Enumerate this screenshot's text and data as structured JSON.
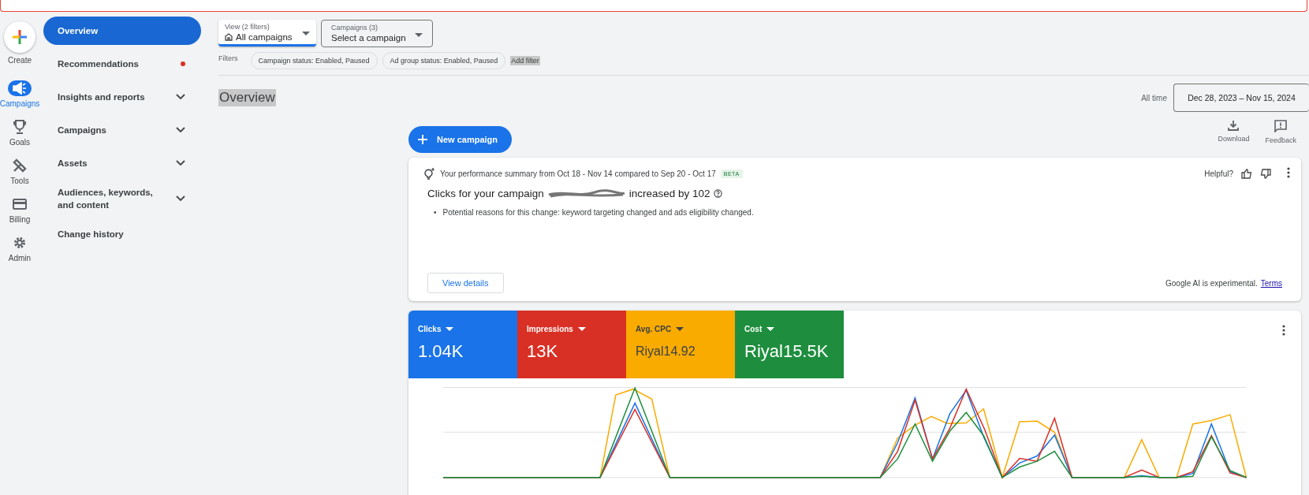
{
  "rail": [
    {
      "label": "Create",
      "kind": "create",
      "selected": false
    },
    {
      "label": "Campaigns",
      "kind": "campaigns",
      "selected": true
    },
    {
      "label": "Goals",
      "kind": "goals",
      "selected": false
    },
    {
      "label": "Tools",
      "kind": "tools",
      "selected": false
    },
    {
      "label": "Billing",
      "kind": "billing",
      "selected": false
    },
    {
      "label": "Admin",
      "kind": "admin",
      "selected": false
    }
  ],
  "nav": [
    {
      "label": "Overview",
      "selected": true,
      "expandable": false,
      "notification": false
    },
    {
      "label": "Recommendations",
      "selected": false,
      "expandable": false,
      "notification": true
    },
    {
      "label": "Insights and reports",
      "selected": false,
      "expandable": true,
      "notification": false
    },
    {
      "label": "Campaigns",
      "selected": false,
      "expandable": true,
      "notification": false
    },
    {
      "label": "Assets",
      "selected": false,
      "expandable": true,
      "notification": false
    },
    {
      "label": "Audiences, keywords, and content",
      "selected": false,
      "expandable": true,
      "notification": false
    },
    {
      "label": "Change history",
      "selected": false,
      "expandable": false,
      "notification": false
    }
  ],
  "view_selector": {
    "label": "View (2 filters)",
    "value": "All campaigns"
  },
  "campaign_selector": {
    "label": "Campaigns (3)",
    "value": "Select a campaign"
  },
  "filters": {
    "label": "Filters",
    "chips": [
      "Campaign status: Enabled, Paused",
      "Ad group status: Enabled, Paused"
    ],
    "add": "Add filter"
  },
  "page_title": "Overview",
  "date_range": {
    "label": "All time",
    "value": "Dec 28, 2023 – Nov 15, 2024"
  },
  "new_campaign": "New campaign",
  "actions": [
    {
      "label": "Download",
      "kind": "download"
    },
    {
      "label": "Feedback",
      "kind": "feedback"
    }
  ],
  "summary": {
    "title": "Your performance summary from Oct 18 - Nov 14 compared to Sep 20 - Oct 17",
    "badge": "BETA",
    "helpful": "Helpful?",
    "headline_start": "Clicks for your campaign",
    "headline_end": "increased by 102",
    "bullet": "•",
    "bullets": [
      "Potential reasons for this change: keyword targeting changed and ads eligibility changed."
    ],
    "button": "View details",
    "disclaimer": "Google AI is experimental.",
    "link": "Terms"
  },
  "metrics": [
    {
      "label": "Clicks",
      "value": "1.04K",
      "color": "#1a73e8"
    },
    {
      "label": "Impressions",
      "value": "13K",
      "color": "#d93025"
    },
    {
      "label": "Avg. CPC",
      "value": "Riyal14.92",
      "color": "#f9ab00"
    },
    {
      "label": "Cost",
      "value": "Riyal15.5K",
      "color": "#1e8e3e"
    }
  ]
}
